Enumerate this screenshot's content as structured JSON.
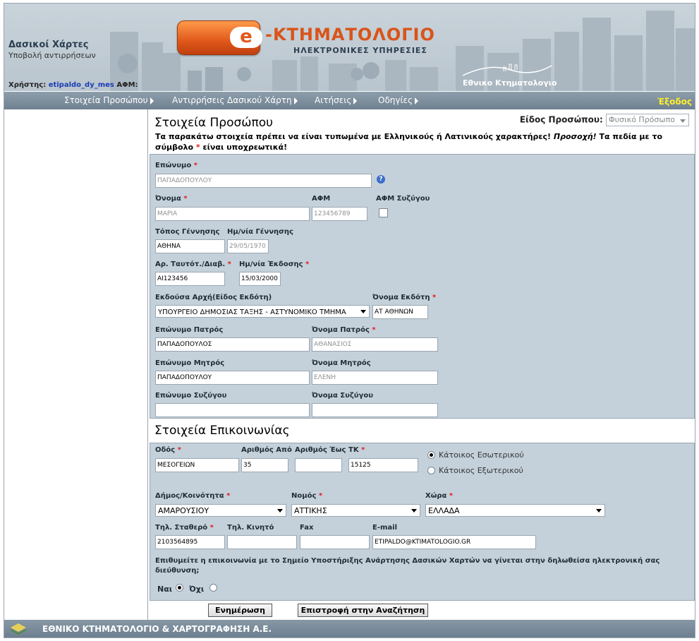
{
  "header": {
    "app_title": "Δασικοί Χάρτες",
    "app_subtitle": "Υποβολή αντιρρήσεων",
    "user_label": "Χρήστης:",
    "user_name": "etipaldo_dy_mes",
    "afm_label": "ΑΦΜ:",
    "logo_letter": "e",
    "logo_word": "-ΚΤΗΜΑΤΟΛΟΓΙΟ",
    "logo_tagline": "ΗΛΕΚΤΡΟΝΙΚΕΣ ΥΠΗΡΕΣΙΕΣ",
    "org_logo_text": "Εθνικο Κτηματολογιο"
  },
  "nav": {
    "items": [
      {
        "label": "Στοιχεία Προσώπου"
      },
      {
        "label": "Αντιρρήσεις Δασικού Χάρτη"
      },
      {
        "label": "Αιτήσεις"
      },
      {
        "label": "Οδηγίες"
      }
    ],
    "exit_label": "Έξοδος"
  },
  "person": {
    "section_title": "Στοιχεία Προσώπου",
    "type_label": "Είδος Προσώπου:",
    "type_value": "Φυσικό Πρόσωπο",
    "notice_a": "Τα παρακάτω στοιχεία πρέπει να είναι τυπωμένα με Ελληνικούς ή Λατινικούς χαρακτήρες!",
    "notice_em": "Προσοχή!",
    "notice_b": "Τα πεδία με το σύμβολο",
    "notice_star": "*",
    "notice_c": "είναι υποχρεωτικά!",
    "req_mark": "*",
    "help_glyph": "?",
    "fields": {
      "surname": {
        "label": "Επώνυμο",
        "value": "ΠΑΠΑΔΟΠΟΥΛΟΥ"
      },
      "name": {
        "label": "Όνομα",
        "value": "ΜΑΡΙΑ"
      },
      "afm": {
        "label": "ΑΦΜ",
        "value": "123456789"
      },
      "spouse_afm": {
        "label": "ΑΦΜ Συζύγου"
      },
      "birth_place": {
        "label": "Τόπος Γέννησης",
        "value": "ΑΘΗΝΑ"
      },
      "birth_date": {
        "label": "Ημ/νία Γέννησης",
        "value": "29/05/1970"
      },
      "id_number": {
        "label": "Αρ. Ταυτότ./Διαβ.",
        "value": "ΑΙ123456"
      },
      "issue_date": {
        "label": "Ημ/νία Έκδοσης",
        "value": "15/03/2000"
      },
      "issuer_authority": {
        "label": "Εκδούσα Αρχή(Είδος Εκδότη)",
        "value": "ΥΠΟΥΡΓΕΙΟ ΔΗΜΟΣΙΑΣ ΤΑΞΗΣ - ΑΣΤΥΝΟΜΙΚΟ ΤΜΗΜΑ"
      },
      "issuer_name": {
        "label": "Όνομα Εκδότη",
        "value": "ΑΤ ΑΘΗΝΩΝ"
      },
      "father_surname": {
        "label": "Επώνυμο Πατρός",
        "value": "ΠΑΠΑΔΟΠΟΥΛΟΣ"
      },
      "father_name": {
        "label": "Όνομα Πατρός",
        "value": "ΑΘΑΝΑΣΙΟΣ"
      },
      "mother_surname": {
        "label": "Επώνυμο Μητρός",
        "value": "ΠΑΠΑΔΟΠΟΥΛΟΥ"
      },
      "mother_name": {
        "label": "Όνομα Μητρός",
        "value": "ΕΛΕΝΗ"
      },
      "spouse_surname": {
        "label": "Επώνυμο Συζύγου",
        "value": ""
      },
      "spouse_name": {
        "label": "Όνομα Συζύγου",
        "value": ""
      }
    }
  },
  "contact": {
    "section_title": "Στοιχεία Επικοινωνίας",
    "fields": {
      "street": {
        "label": "Οδός",
        "value": "ΜΕΣΟΓΕΙΩΝ"
      },
      "number_from": {
        "label": "Αριθμός Από",
        "value": "35"
      },
      "number_to": {
        "label": "Αριθμός Έως",
        "value": ""
      },
      "postcode": {
        "label": "ΤΚ",
        "value": "15125"
      },
      "municipality": {
        "label": "Δήμος/Κοινότητα",
        "value": "ΑΜΑΡΟΥΣΙΟΥ"
      },
      "prefecture": {
        "label": "Νομός",
        "value": "ΑΤΤΙΚΗΣ"
      },
      "country": {
        "label": "Χώρα",
        "value": "ΕΛΛΑΔΑ"
      },
      "phone": {
        "label": "Τηλ. Σταθερό",
        "value": "2103564895"
      },
      "mobile": {
        "label": "Τηλ. Κινητό",
        "value": ""
      },
      "fax": {
        "label": "Fax",
        "value": ""
      },
      "email": {
        "label": "E-mail",
        "value": "ETIPALDO@KTIMATOLOGIO.GR"
      }
    },
    "residence_options": [
      {
        "label": "Κάτοικος Εσωτερικού",
        "selected": true
      },
      {
        "label": "Κάτοικος Εξωτερικού",
        "selected": false
      }
    ],
    "consent_question": "Επιθυμείτε η επικοινωνία με το Σημείο Υποστήριξης Ανάρτησης Δασικών Χαρτών να γίνεται στην δηλωθείσα ηλεκτρονική σας διεύθυνση;",
    "consent_yes": "Ναι",
    "consent_no": "Όχι",
    "consent_value": "Ναι"
  },
  "buttons": {
    "update_label": "Ενημέρωση",
    "back_label": "Επιστροφή στην Αναζήτηση"
  },
  "footer": {
    "text": "ΕΘΝΙΚΟ ΚΤΗΜΑΤΟΛΟΓΙΟ & ΧΑΡΤΟΓΡΑΦΗΣΗ Α.Ε."
  },
  "colors": {
    "brand_orange": "#e0581a",
    "nav_bg": "#7d8e9c",
    "panel_bg": "#c4d1db",
    "exit_yellow": "#ffef2a",
    "required_red": "#e02020"
  }
}
